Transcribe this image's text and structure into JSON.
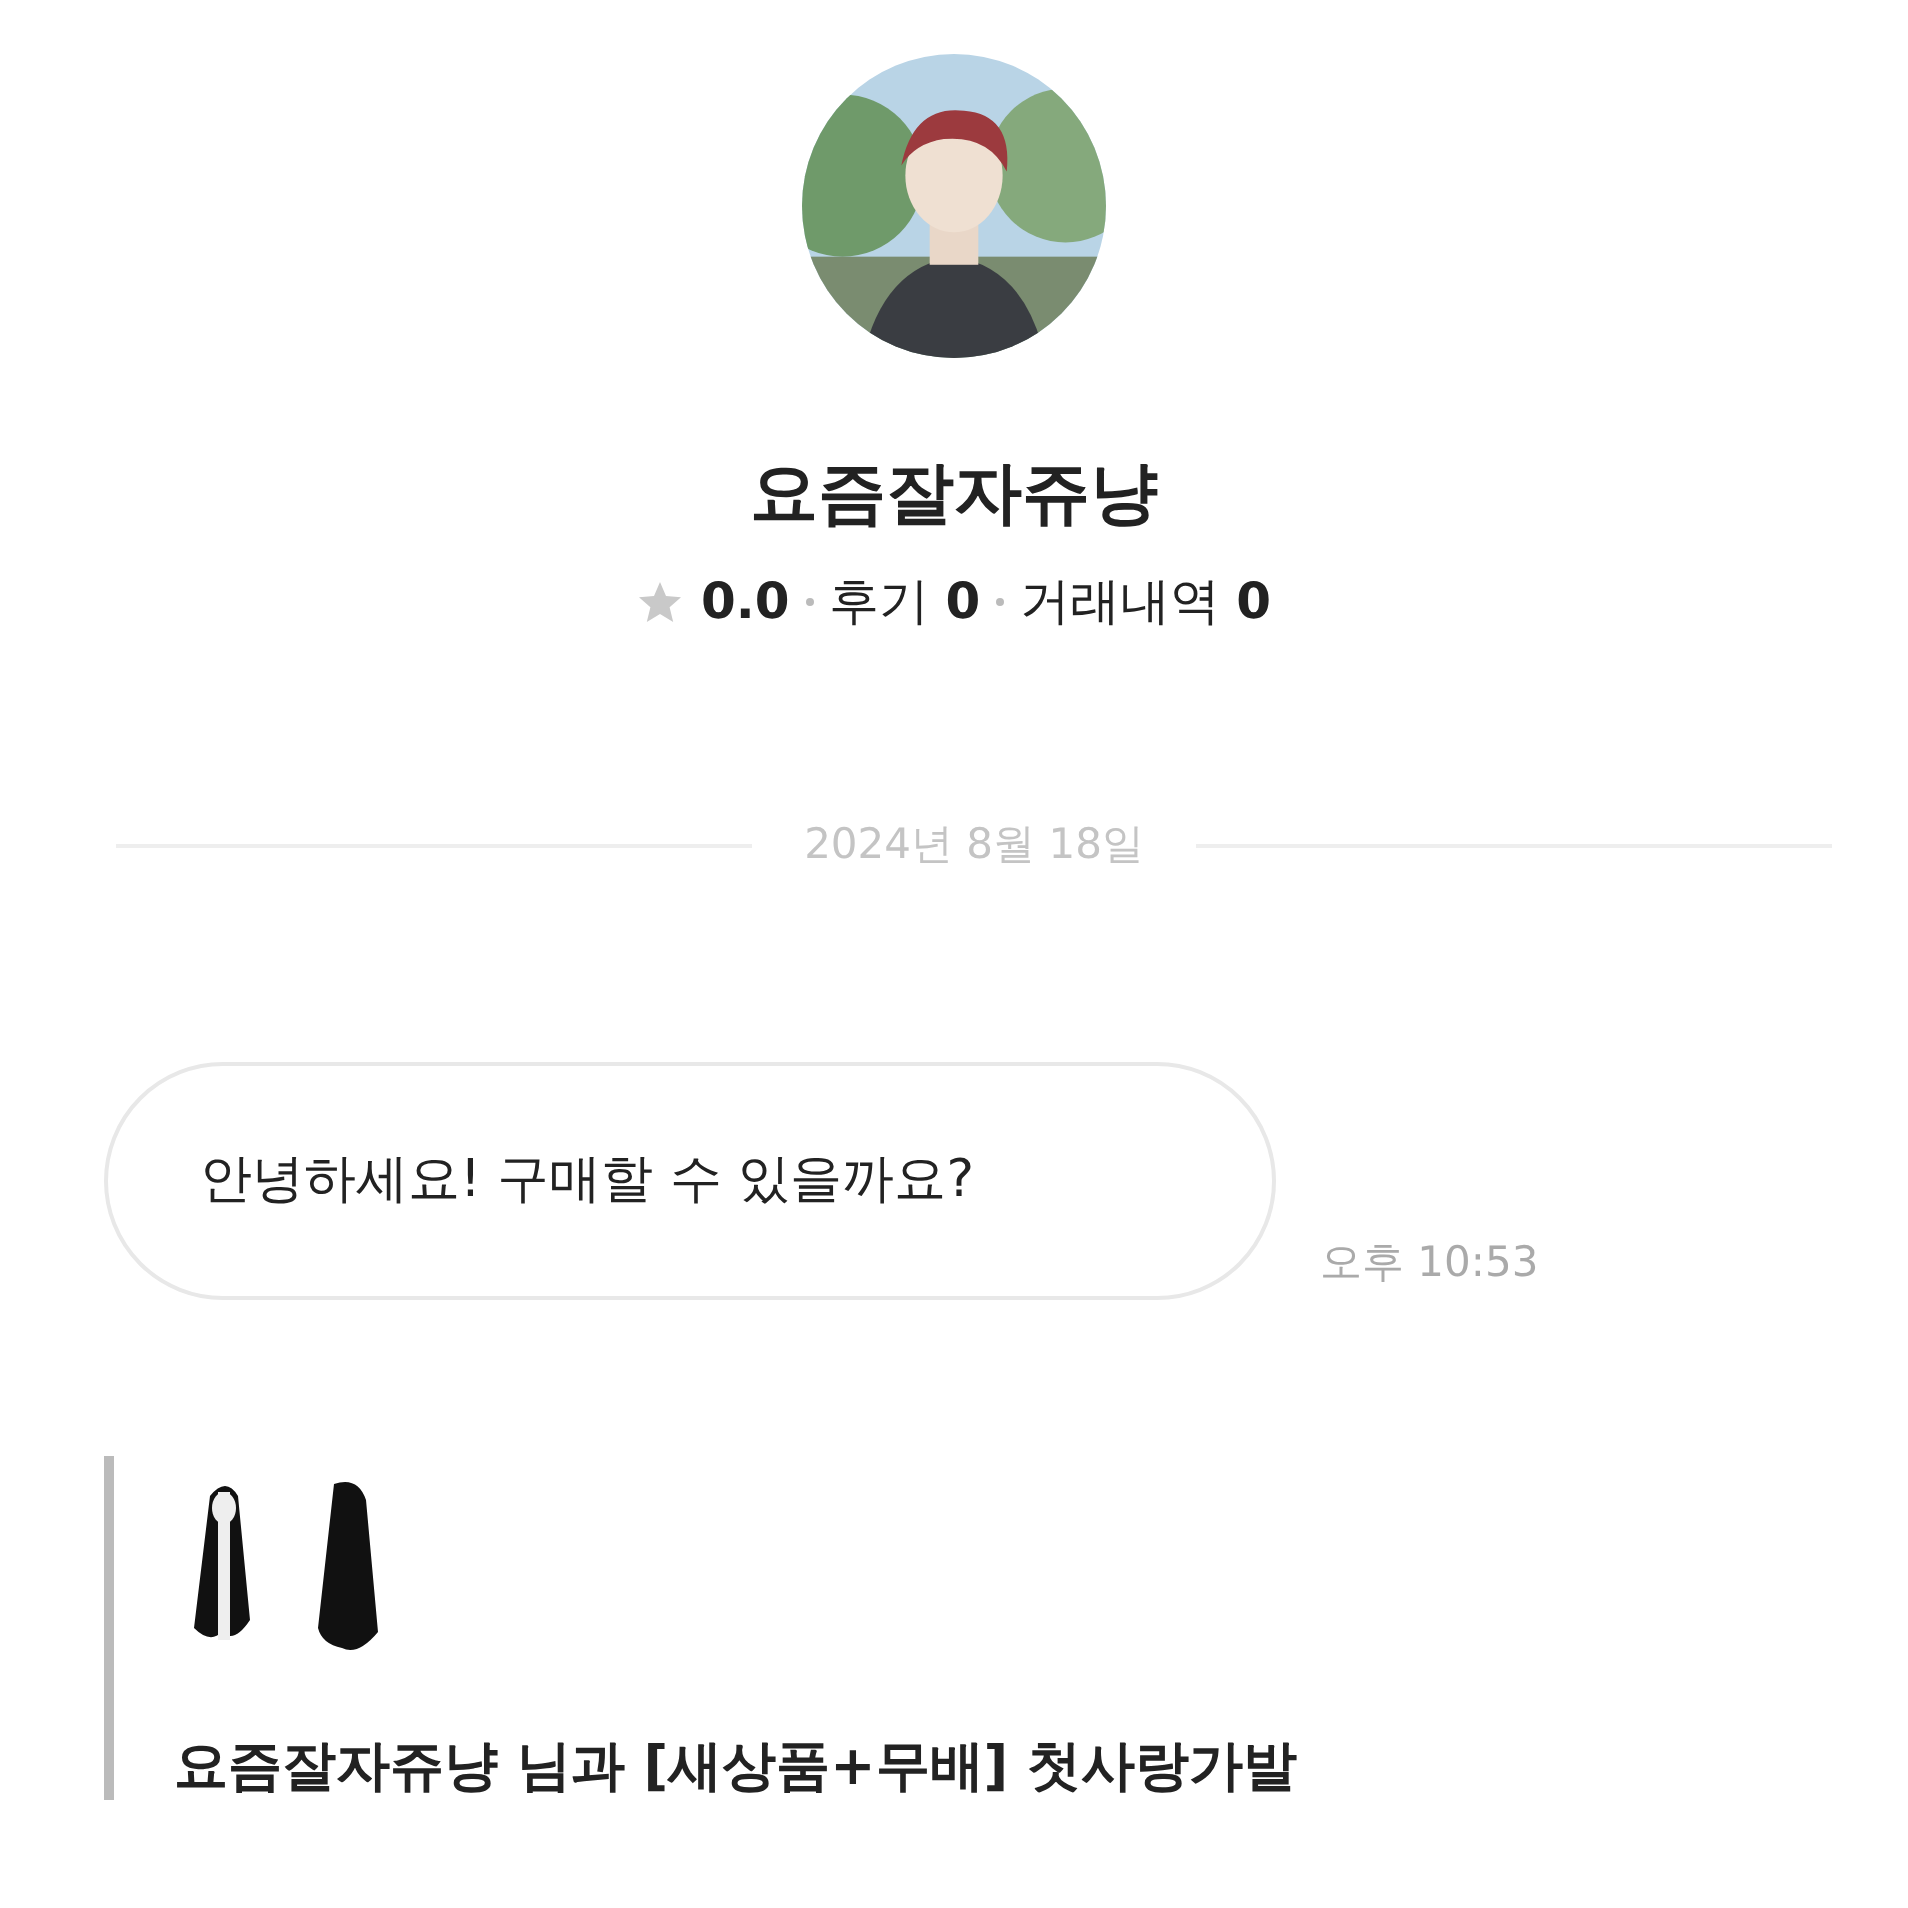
{
  "profile": {
    "name": "요즘잘자쥬냥",
    "rating": "0.0",
    "reviews_label": "후기",
    "reviews": "0",
    "trades_label": "거래내역",
    "trades": "0"
  },
  "date_divider": "2024년 8월 18일",
  "messages": [
    {
      "text": "안녕하세요! 구매할 수 있을까요?",
      "time": "오후 10:53"
    }
  ],
  "product_card": {
    "title": "요즘잘자쥬냥 님과 [새상품+무배] 첫사랑가발"
  }
}
